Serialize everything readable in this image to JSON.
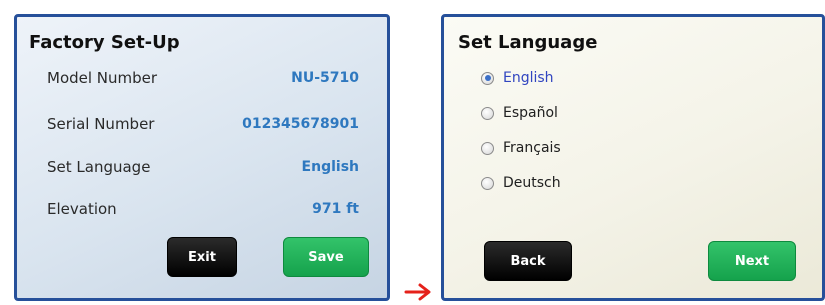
{
  "factory_setup": {
    "title": "Factory Set-Up",
    "rows": [
      {
        "label": "Model Number",
        "value": "NU-5710"
      },
      {
        "label": "Serial Number",
        "value": "012345678901"
      },
      {
        "label": "Set Language",
        "value": "English"
      },
      {
        "label": "Elevation",
        "value": "971 ft"
      }
    ],
    "exit_label": "Exit",
    "save_label": "Save"
  },
  "set_language": {
    "title": "Set Language",
    "options": [
      {
        "label": "English",
        "selected": true
      },
      {
        "label": "Español",
        "selected": false
      },
      {
        "label": "Français",
        "selected": false
      },
      {
        "label": "Deutsch",
        "selected": false
      }
    ],
    "back_label": "Back",
    "next_label": "Next"
  },
  "colors": {
    "frame_border": "#26509a",
    "value_text": "#2e78bf",
    "save_next_green": "#15a24c",
    "selected_option": "#3145c0",
    "arrow": "#e5211a"
  },
  "icons": {
    "transition_arrow": "right-arrow-icon"
  }
}
